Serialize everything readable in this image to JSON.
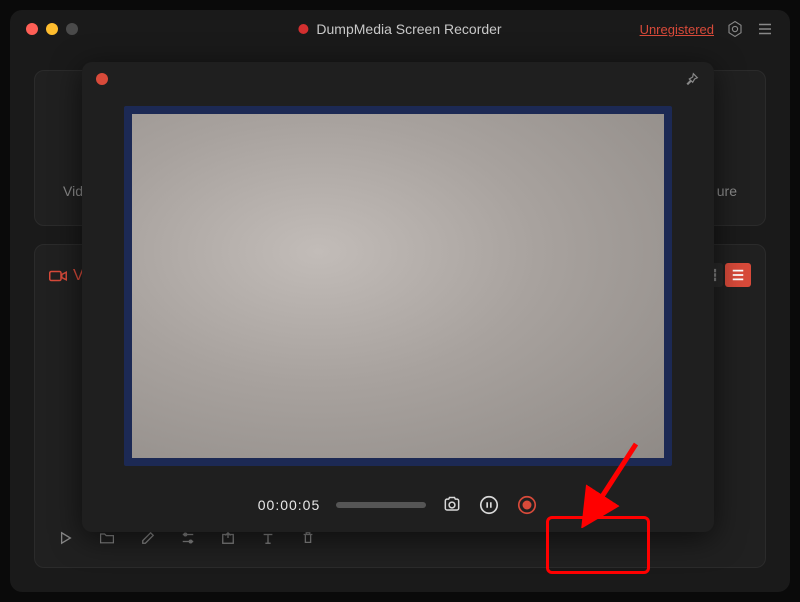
{
  "titlebar": {
    "app_title": "DumpMedia Screen Recorder",
    "unregistered_label": "Unregistered"
  },
  "main": {
    "top_label_left": "Vide",
    "top_label_right": "ure",
    "tab_label": "V"
  },
  "recorder": {
    "timer": "00:00:05"
  },
  "colors": {
    "accent_red": "#d84a3a",
    "highlight_red": "#ff0000"
  }
}
